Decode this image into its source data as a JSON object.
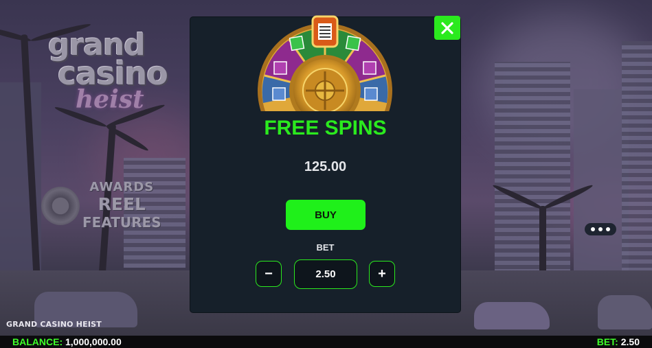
{
  "game": {
    "logo_line1": "grand",
    "logo_line2": "casino",
    "logo_line3": "heist",
    "awards_line1": "AWARDS",
    "awards_line2": "REEL",
    "awards_line3": "FEATURES",
    "title_tag": "GRAND CASINO HEIST"
  },
  "modal": {
    "title": "FREE SPINS",
    "price": "125.00",
    "buy_label": "BUY",
    "bet_label": "BET",
    "bet_value": "2.50",
    "minus_label": "−",
    "plus_label": "+",
    "close_icon": "close-icon"
  },
  "footer": {
    "balance_label": "BALANCE:",
    "balance_value": "1,000,000.00",
    "bet_label": "BET:",
    "bet_value": "2.50"
  },
  "colors": {
    "accent_green": "#2bea1e",
    "modal_bg": "#16202a",
    "wheel_gold": "#d89a2a",
    "wheel_purple": "#8e2a8e",
    "wheel_green": "#2a8a3a"
  }
}
